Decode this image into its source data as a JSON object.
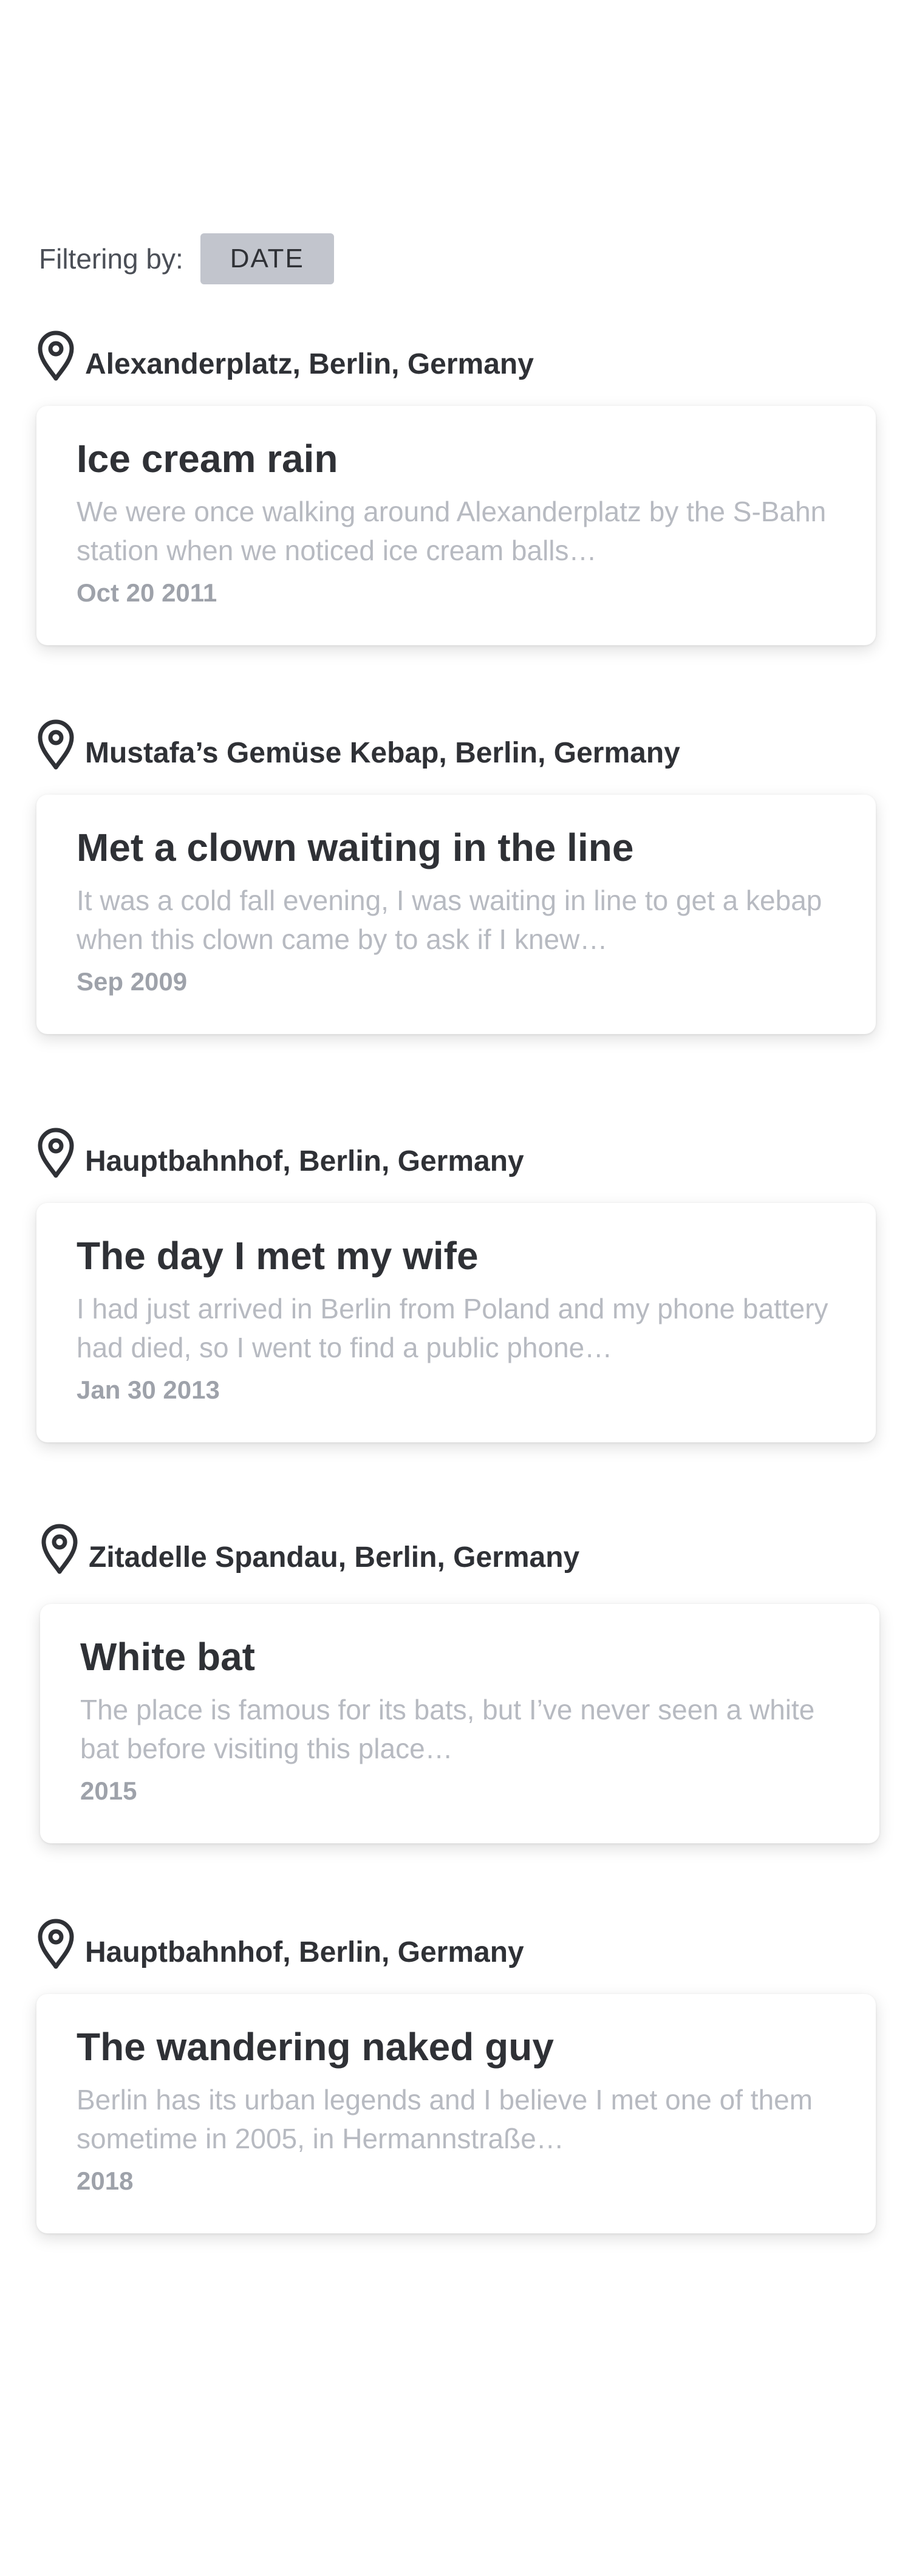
{
  "filter": {
    "label": "Filtering by:",
    "value": "DATE"
  },
  "entries": [
    {
      "location": "Alexanderplatz, Berlin, Germany",
      "title": "Ice cream rain",
      "excerpt": "We were once walking around Alexanderplatz by the S-Bahn station when we noticed ice cream balls…",
      "date": "Oct 20 2011"
    },
    {
      "location": "Mustafa’s Gemüse Kebap, Berlin, Germany",
      "title": "Met a clown waiting in the line",
      "excerpt": "It was a cold fall evening, I was waiting in line to get a kebap when this clown came by to ask if I knew…",
      "date": "Sep 2009"
    },
    {
      "location": "Hauptbahnhof, Berlin, Germany",
      "title": "The day I met my wife",
      "excerpt": "I had just arrived in Berlin from Poland and my phone battery had died, so I went to find a public phone…",
      "date": "Jan 30 2013"
    },
    {
      "location": "Zitadelle Spandau, Berlin, Germany",
      "title": "White bat",
      "excerpt": "The place is famous for its bats, but I’ve never seen a white bat before visiting this place…",
      "date": "2015"
    },
    {
      "location": "Hauptbahnhof, Berlin, Germany",
      "title": "The wandering naked guy",
      "excerpt": "Berlin has its urban legends and I believe I met one of them sometime in 2005, in Hermannstraße…",
      "date": "2018"
    }
  ]
}
